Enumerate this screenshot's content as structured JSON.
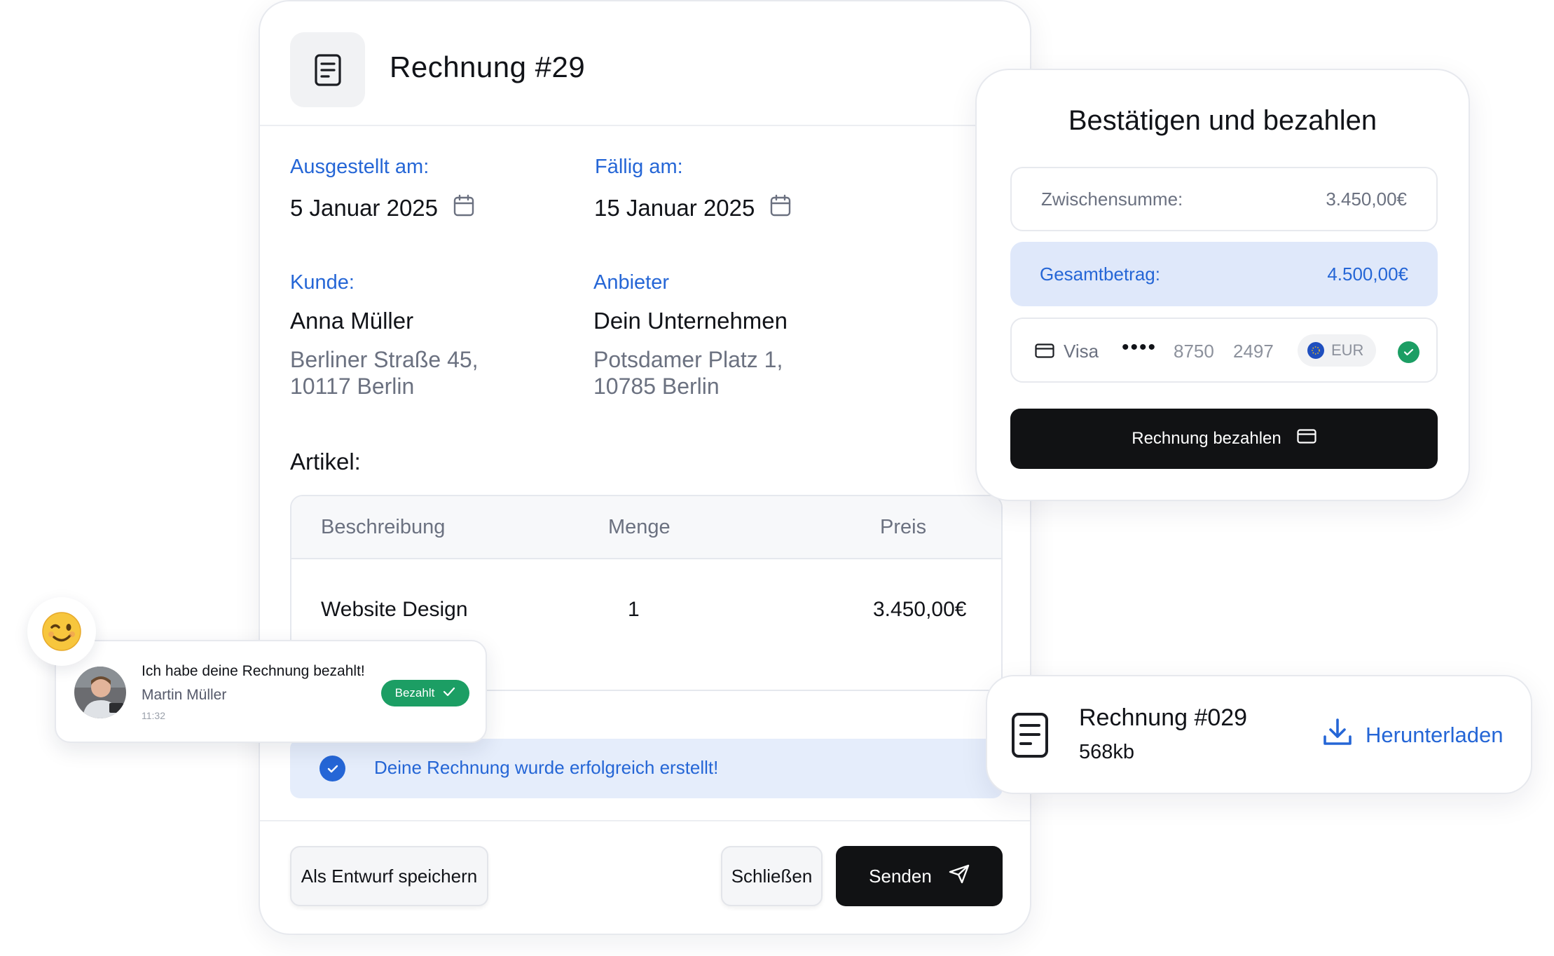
{
  "invoice": {
    "title": "Rechnung #29",
    "issued_label": "Ausgestellt am:",
    "issued_date": "5 Januar 2025",
    "due_label": "Fällig am:",
    "due_date": "15 Januar 2025",
    "customer_label": "Kunde:",
    "customer_name": "Anna Müller",
    "customer_street": "Berliner Straße 45,",
    "customer_city": "10117 Berlin",
    "provider_label": "Anbieter",
    "provider_name": "Dein Unternehmen",
    "provider_street": "Potsdamer Platz 1,",
    "provider_city": "10785 Berlin",
    "articles_label": "Artikel:",
    "table": {
      "headers": [
        "Beschreibung",
        "Menge",
        "Preis"
      ],
      "rows": [
        {
          "description": "Website Design",
          "quantity": "1",
          "price": "3.450,00€"
        }
      ]
    },
    "success_message": "Deine Rechnung wurde erfolgreich erstellt!",
    "save_draft_label": "Als Entwurf speichern",
    "close_label": "Schließen",
    "send_label": "Senden"
  },
  "payment": {
    "title": "Bestätigen und bezahlen",
    "subtotal_label": "Zwischensumme:",
    "subtotal_value": "3.450,00€",
    "total_label": "Gesamtbetrag:",
    "total_value": "4.500,00€",
    "card_brand": "Visa",
    "card_dots": "••••",
    "card_group1": "8750",
    "card_group2": "2497",
    "currency": "EUR",
    "pay_label": "Rechnung bezahlen"
  },
  "download": {
    "title": "Rechnung #029",
    "size": "568kb",
    "action_label": "Herunterladen"
  },
  "chat": {
    "emoji": "😉",
    "message": "Ich habe deine Rechnung bezahlt!",
    "sender": "Martin Müller",
    "time": "11:32",
    "badge": "Bezahlt"
  },
  "colors": {
    "accent_blue": "#2566d6",
    "success_green": "#1c9e64",
    "dark_button": "#111214",
    "muted_text": "#6b7180"
  }
}
